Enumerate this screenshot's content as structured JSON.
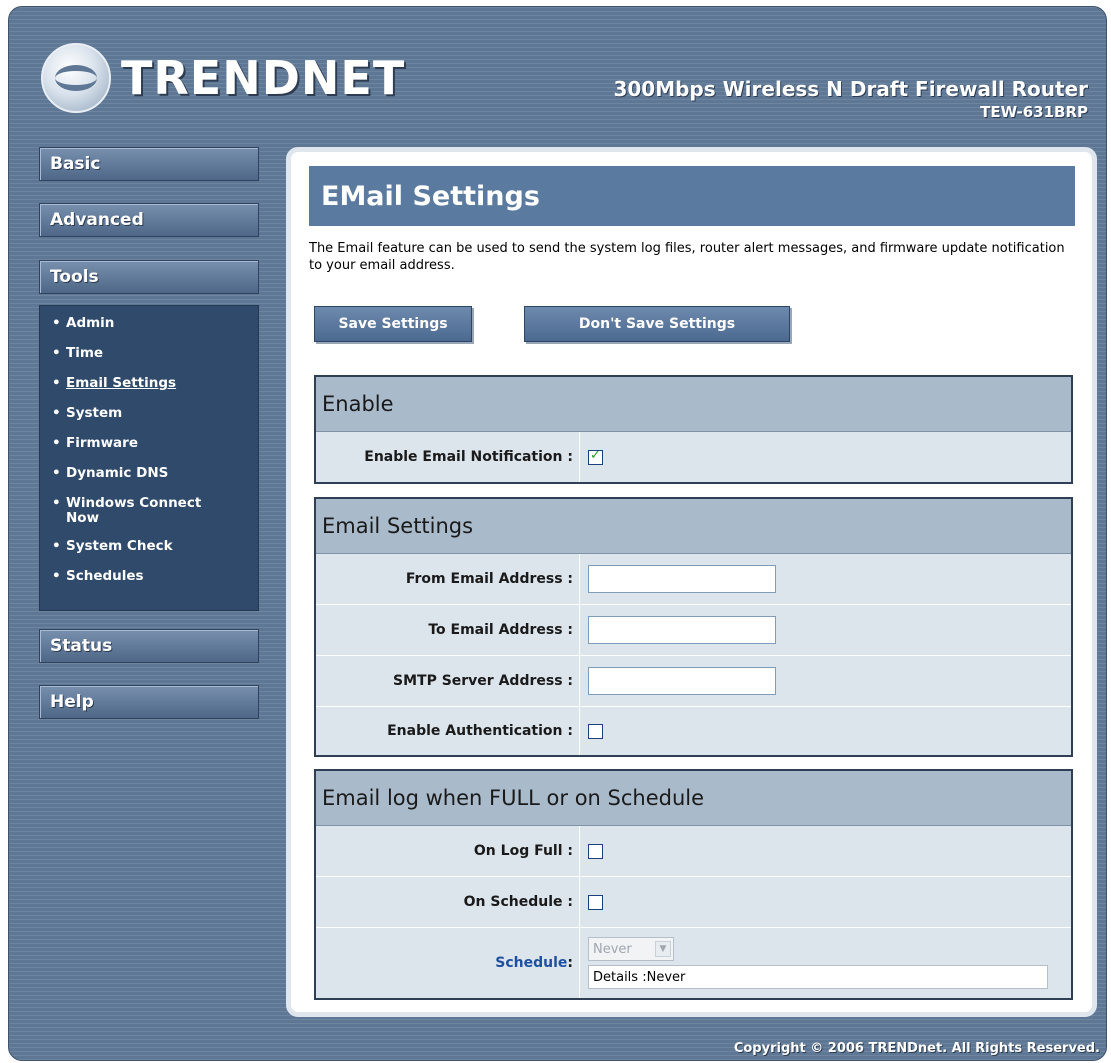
{
  "header": {
    "brand": "TRENDNET",
    "product_line": "300Mbps Wireless N Draft Firewall Router",
    "model": "TEW-631BRP"
  },
  "sidebar": {
    "basic": "Basic",
    "advanced": "Advanced",
    "tools": "Tools",
    "tools_items": [
      "Admin",
      "Time",
      "Email Settings",
      "System",
      "Firmware",
      "Dynamic DNS",
      "Windows Connect Now",
      "System Check",
      "Schedules"
    ],
    "status": "Status",
    "help": "Help"
  },
  "page": {
    "title": "EMail Settings",
    "description": "The Email feature can be used to send the system log files, router alert messages, and firmware update notification to your email address.",
    "save_button": "Save Settings",
    "dont_save_button": "Don't Save Settings"
  },
  "enable_section": {
    "heading": "Enable",
    "enable_email_label": "Enable Email Notification :",
    "enable_email_checked": true
  },
  "email_section": {
    "heading": "Email Settings",
    "from_label": "From Email Address :",
    "from_value": "",
    "to_label": "To Email Address :",
    "to_value": "",
    "smtp_label": "SMTP Server Address :",
    "smtp_value": "",
    "auth_label": "Enable Authentication :",
    "auth_checked": false
  },
  "log_section": {
    "heading": "Email log when FULL or on Schedule",
    "log_full_label": "On Log Full :",
    "log_full_checked": false,
    "on_schedule_label": "On Schedule :",
    "on_schedule_checked": false,
    "schedule_label": "Schedule",
    "schedule_colon": " :",
    "schedule_value": "Never",
    "details_label": "Details : ",
    "details_value": "Never"
  },
  "footer": {
    "copyright": "Copyright © 2006 TRENDnet. All Rights Reserved."
  }
}
